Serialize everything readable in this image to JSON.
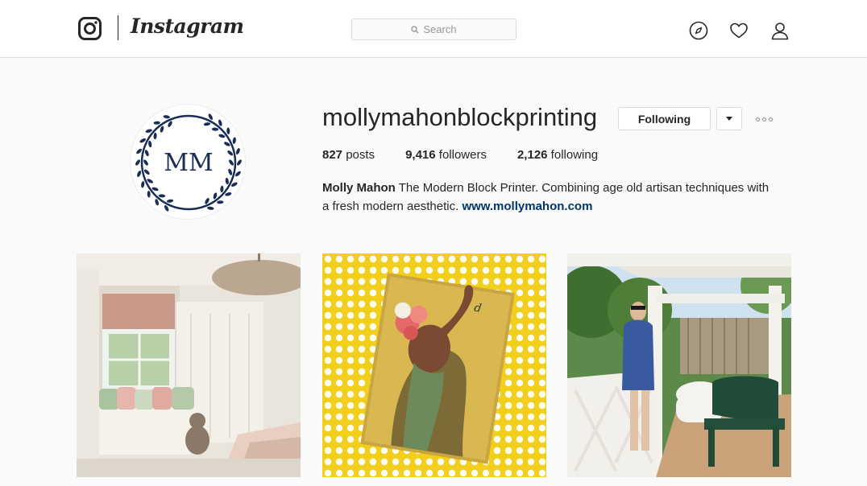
{
  "header": {
    "brand": "Instagram",
    "search_placeholder": "Search",
    "icons": [
      "instagram-logo-icon",
      "search-icon",
      "compass-icon",
      "heart-icon",
      "profile-icon"
    ]
  },
  "profile": {
    "avatar_monogram": "MM",
    "username": "mollymahonblockprinting",
    "follow_button": "Following",
    "posts_count": "827",
    "posts_label": " posts",
    "followers_count": "9,416",
    "followers_label": " followers",
    "following_count": "2,126",
    "following_label": " following",
    "bio_name": "Molly Mahon",
    "bio_text": " The Modern Block Printer. Combining age old artisan techniques with a fresh modern aesthetic. ",
    "bio_link": "www.mollymahon.com"
  },
  "colors": {
    "link": "#003569",
    "monogram": "#1a2d55",
    "post2_background": "#f2cf1d"
  }
}
